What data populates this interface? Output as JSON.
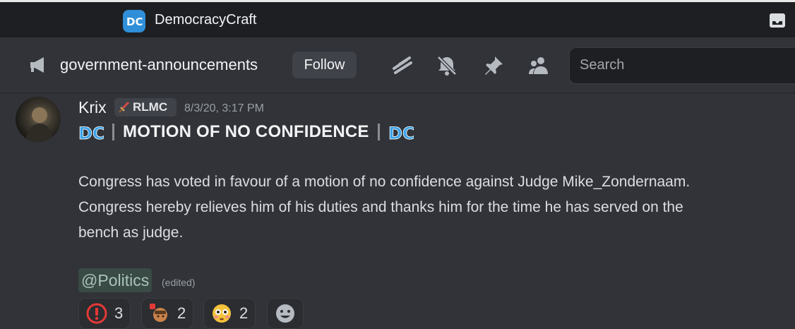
{
  "titlebar": {
    "server_name": "DemocracyCraft",
    "icons": [
      "server-logo-icon",
      "inbox-icon"
    ]
  },
  "channel": {
    "name": "government-announcements",
    "follow_label": "Follow",
    "search_placeholder": "Search",
    "tool_icons": [
      "threads-icon",
      "mute-bell-icon",
      "pin-icon",
      "members-icon"
    ]
  },
  "message": {
    "author": "Krix",
    "role_tag": "RLMC",
    "timestamp": "8/3/20, 3:17 PM",
    "heading": "MOTION OF NO CONFIDENCE",
    "body_line1": "Congress has voted in favour of a motion of no confidence against Judge Mike_Zondernaam.",
    "body_line2": "Congress hereby relieves him of his duties and thanks him for the time he has served on the",
    "body_line3": "bench as judge.",
    "mention": "@Politics",
    "edited": "(edited)"
  },
  "reactions": [
    {
      "emoji": "exclamation-icon",
      "count": "3"
    },
    {
      "emoji": "judge-gavel-icon",
      "count": "2"
    },
    {
      "emoji": "flushed-face-icon",
      "count": "2"
    },
    {
      "emoji": "add-reaction-icon",
      "count": ""
    }
  ],
  "colors": {
    "background": "#313338",
    "titlebar": "#1e1f22",
    "accent_blue": "#2f8fd8",
    "mention_bg": "#3a4a45"
  }
}
